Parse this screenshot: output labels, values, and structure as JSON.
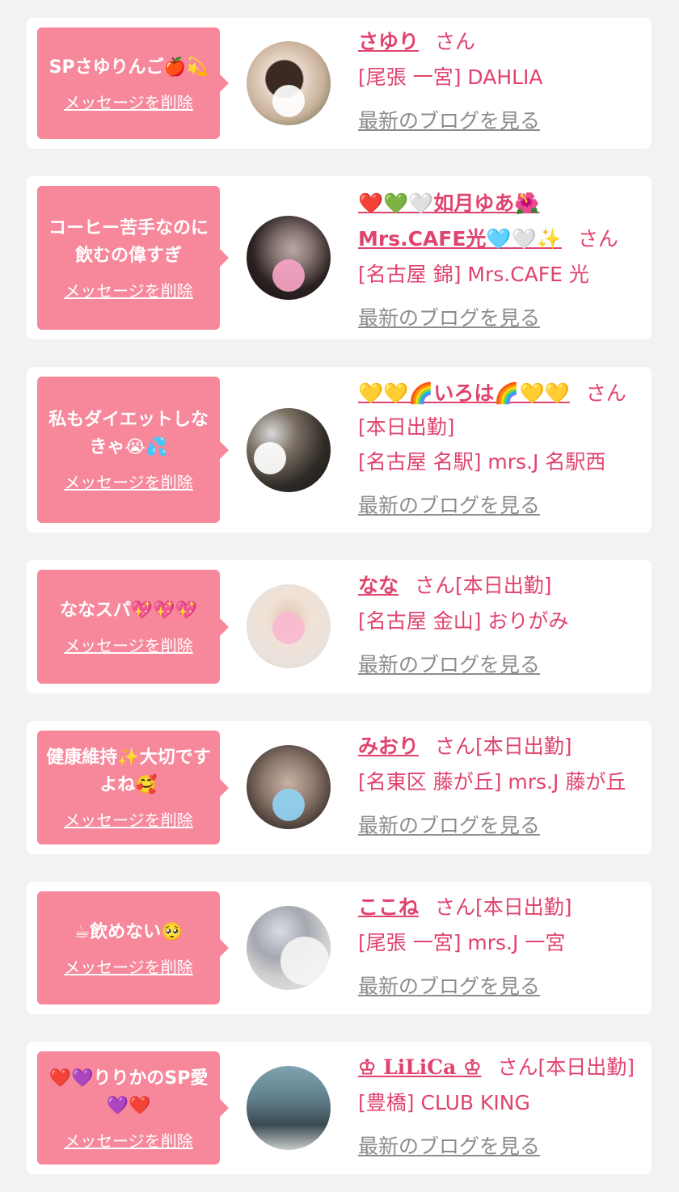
{
  "delete_label": "メッセージを削除",
  "blog_label": "最新のブログを見る",
  "cards": [
    {
      "message": "SPさゆりんご🍎💫",
      "name": "さゆり",
      "suffix": "さん",
      "location": "[尾張 一宮] DAHLIA"
    },
    {
      "message": "コーヒー苦手なのに飲むの偉すぎ",
      "name": "❤️💚🤍如月ゆあ🌺 Mrs.CAFE光🩵🤍✨",
      "suffix": "さん",
      "location": "[名古屋 錦] Mrs.CAFE 光"
    },
    {
      "message": "私もダイエットしなきゃ😭💦",
      "name": "💛💛🌈いろは🌈💛💛",
      "suffix": "さん[本日出勤]",
      "location": "[名古屋 名駅] mrs.J 名駅西"
    },
    {
      "message": "ななスパ💖💖💖",
      "name": "なな",
      "suffix": "さん[本日出勤]",
      "location": "[名古屋 金山] おりがみ"
    },
    {
      "message": "健康維持✨大切ですよね🥰",
      "name": "みおり",
      "suffix": "さん[本日出勤]",
      "location": "[名東区 藤が丘] mrs.J 藤が丘"
    },
    {
      "message": "☕飲めない🥺",
      "name": "ここね",
      "suffix": "さん[本日出勤]",
      "location": "[尾張 一宮] mrs.J 一宮"
    },
    {
      "message": "❤️💜りりかのSP愛💜❤️",
      "name": "♔ LiLiCa ♔",
      "suffix": "さん[本日出勤]",
      "location": "[豊橋] CLUB KING"
    }
  ]
}
